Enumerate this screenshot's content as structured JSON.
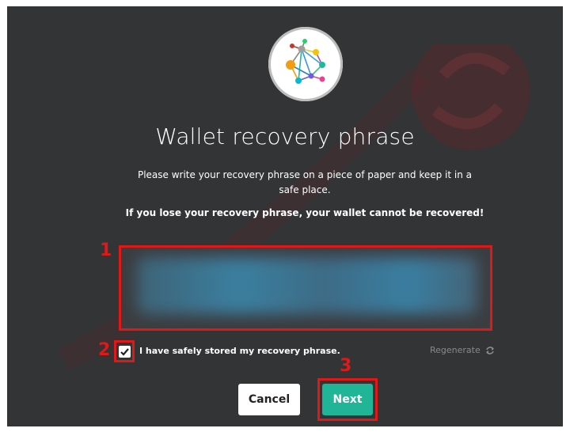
{
  "dialog": {
    "logo_icon": "network-graph-logo-icon",
    "title": "Wallet recovery phrase",
    "instruction": "Please write your recovery phrase on a piece of paper and keep it in a safe place.",
    "warning": "If you lose your recovery phrase, your wallet cannot be recovered!",
    "recovery_phrase": "",
    "stored_label": "I have safely stored my recovery phrase.",
    "stored_checked": true,
    "regenerate_label": "Regenerate",
    "regenerate_icon": "refresh-icon",
    "cancel_label": "Cancel",
    "next_label": "Next"
  },
  "annotations": {
    "callout_1": "1",
    "callout_2": "2",
    "callout_3": "3"
  },
  "colors": {
    "background": "#333436",
    "accent": "#1fb596",
    "callout": "#e01818"
  }
}
